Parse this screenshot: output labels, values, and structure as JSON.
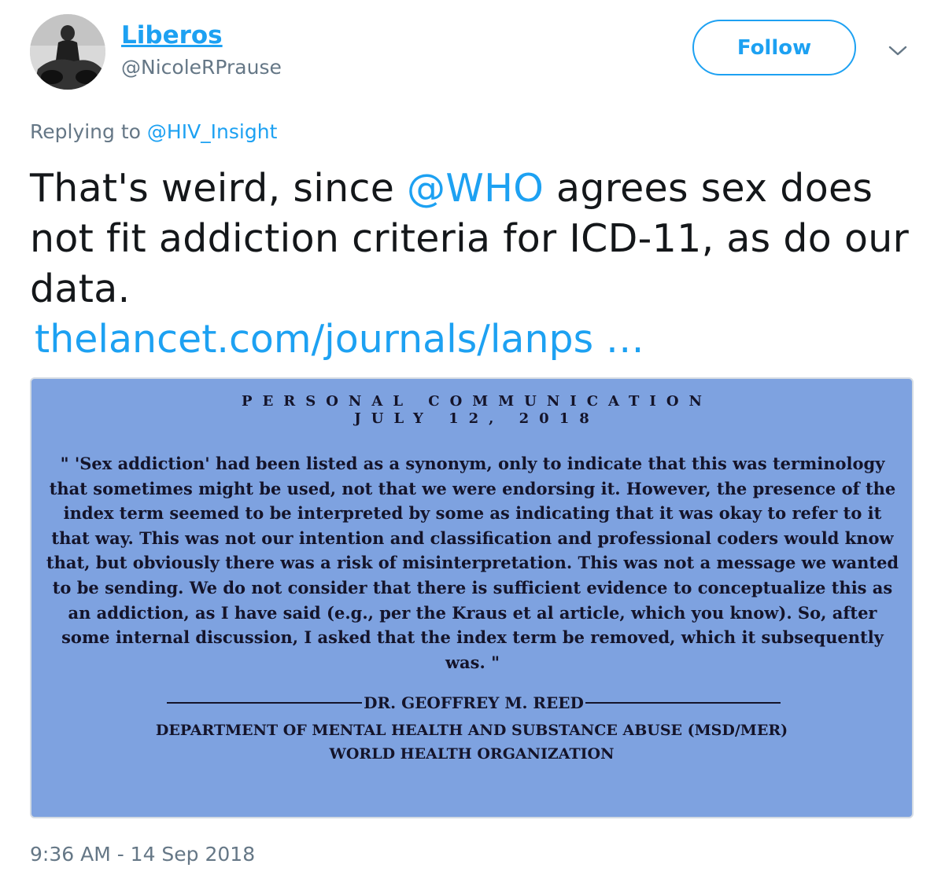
{
  "tweet": {
    "author": {
      "display_name": "Liberos",
      "handle": "@NicoleRPrause"
    },
    "follow_label": "Follow",
    "caret_icon": "chevron-down-icon",
    "replying_prefix": "Replying to",
    "replying_to": "@HIV_Insight",
    "text_before": "That's weird, since ",
    "mention": "@WHO",
    "text_after": " agrees sex does not fit addiction criteria for ICD-11, as do our data.",
    "link": "thelancet.com/journals/lanps  …",
    "timestamp": "9:36 AM - 14 Sep 2018",
    "colors": {
      "accent": "#1da1f2",
      "secondary_text": "#657786",
      "card_bg": "#7ea2e0"
    }
  },
  "card": {
    "title": "PERSONAL COMMUNICATION",
    "date": "JULY 12, 2018",
    "quote": "\" 'Sex addiction' had been listed as a synonym, only to indicate that this was terminology that sometimes might be used, not that we were endorsing it.  However, the presence of the index term seemed to be interpreted by some as indicating that it was okay to refer to it that way.  This was not our intention and classification and professional coders would know that, but obviously there was a risk of misinterpretation.  This was not a message we wanted to be sending.  We do not consider that there is sufficient evidence to conceptualize this as an addiction, as I have said (e.g., per the Kraus et al article, which you know).  So, after some internal discussion, I asked that the index term be removed, which it subsequently was. \"",
    "signature": "DR. GEOFFREY M. REED",
    "department": "DEPARTMENT OF MENTAL HEALTH AND SUBSTANCE ABUSE (MSD/MER)",
    "organization": "WORLD HEALTH ORGANIZATION"
  }
}
